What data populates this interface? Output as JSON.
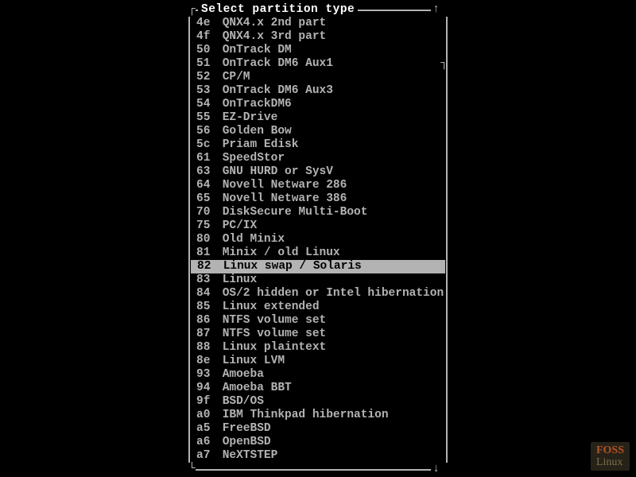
{
  "dialog": {
    "title": "Select partition type",
    "scroll_up_glyph": "↑",
    "scroll_down_glyph": "↓"
  },
  "partition_types": [
    {
      "code": "4e",
      "name": "QNX4.x 2nd part",
      "selected": false
    },
    {
      "code": "4f",
      "name": "QNX4.x 3rd part",
      "selected": false
    },
    {
      "code": "50",
      "name": "OnTrack DM",
      "selected": false
    },
    {
      "code": "51",
      "name": "OnTrack DM6 Aux1",
      "selected": false
    },
    {
      "code": "52",
      "name": "CP/M",
      "selected": false
    },
    {
      "code": "53",
      "name": "OnTrack DM6 Aux3",
      "selected": false
    },
    {
      "code": "54",
      "name": "OnTrackDM6",
      "selected": false
    },
    {
      "code": "55",
      "name": "EZ-Drive",
      "selected": false
    },
    {
      "code": "56",
      "name": "Golden Bow",
      "selected": false
    },
    {
      "code": "5c",
      "name": "Priam Edisk",
      "selected": false
    },
    {
      "code": "61",
      "name": "SpeedStor",
      "selected": false
    },
    {
      "code": "63",
      "name": "GNU HURD or SysV",
      "selected": false
    },
    {
      "code": "64",
      "name": "Novell Netware 286",
      "selected": false
    },
    {
      "code": "65",
      "name": "Novell Netware 386",
      "selected": false
    },
    {
      "code": "70",
      "name": "DiskSecure Multi-Boot",
      "selected": false
    },
    {
      "code": "75",
      "name": "PC/IX",
      "selected": false
    },
    {
      "code": "80",
      "name": "Old Minix",
      "selected": false
    },
    {
      "code": "81",
      "name": "Minix / old Linux",
      "selected": false
    },
    {
      "code": "82",
      "name": "Linux swap / Solaris",
      "selected": true
    },
    {
      "code": "83",
      "name": "Linux",
      "selected": false
    },
    {
      "code": "84",
      "name": "OS/2 hidden or Intel hibernation",
      "selected": false
    },
    {
      "code": "85",
      "name": "Linux extended",
      "selected": false
    },
    {
      "code": "86",
      "name": "NTFS volume set",
      "selected": false
    },
    {
      "code": "87",
      "name": "NTFS volume set",
      "selected": false
    },
    {
      "code": "88",
      "name": "Linux plaintext",
      "selected": false
    },
    {
      "code": "8e",
      "name": "Linux LVM",
      "selected": false
    },
    {
      "code": "93",
      "name": "Amoeba",
      "selected": false
    },
    {
      "code": "94",
      "name": "Amoeba BBT",
      "selected": false
    },
    {
      "code": "9f",
      "name": "BSD/OS",
      "selected": false
    },
    {
      "code": "a0",
      "name": "IBM Thinkpad hibernation",
      "selected": false
    },
    {
      "code": "a5",
      "name": "FreeBSD",
      "selected": false
    },
    {
      "code": "a6",
      "name": "OpenBSD",
      "selected": false
    },
    {
      "code": "a7",
      "name": "NeXTSTEP",
      "selected": false
    }
  ],
  "watermark": {
    "line1": "FOSS",
    "line2": "Linux"
  }
}
